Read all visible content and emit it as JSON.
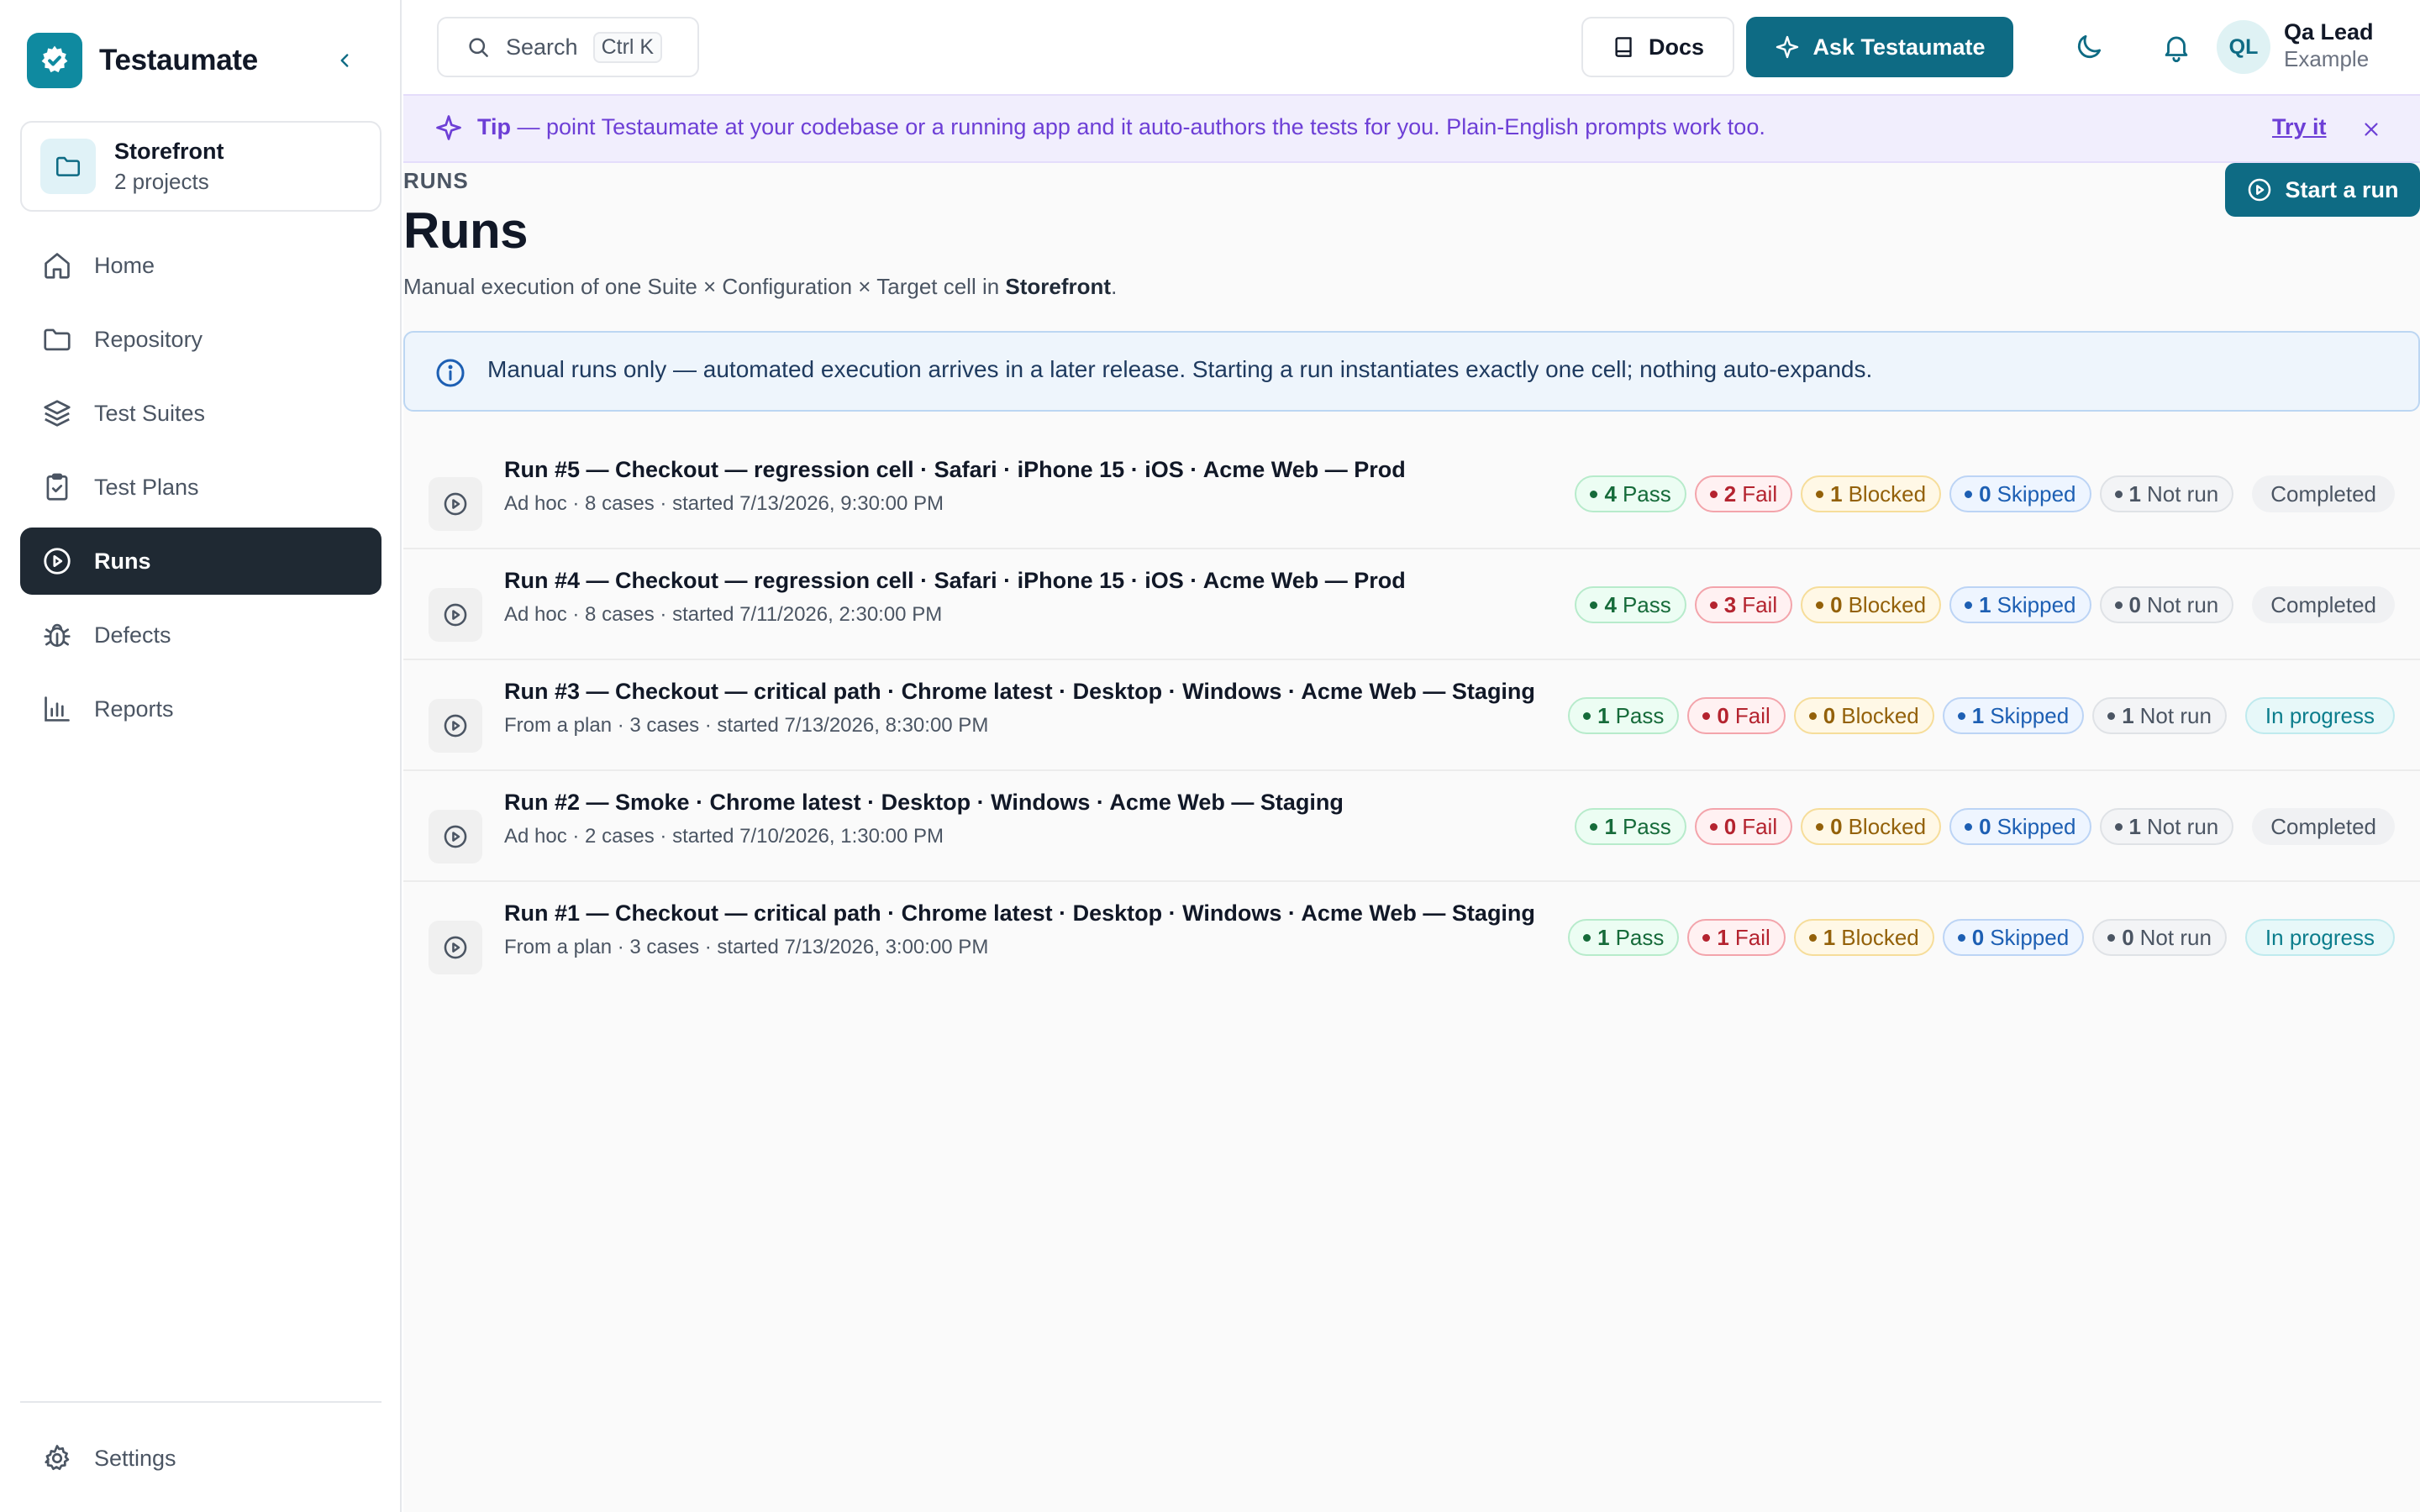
{
  "colors": {
    "brand": "#0f8aa0",
    "primary_button": "#0e6b84",
    "sidebar_active": "#1f2933",
    "tip_text": "#6d3fd6",
    "pass": "#166b3a",
    "fail": "#b4232f",
    "blocked": "#93610a",
    "skipped": "#1d5fb3",
    "not_run": "#4b5563",
    "in_progress": "#0b7d8c"
  },
  "brand": {
    "name": "Testaumate",
    "icon": "gear-icon"
  },
  "workspace": {
    "name": "Storefront",
    "sub": "2 projects",
    "icon": "folder-icon"
  },
  "nav": [
    {
      "label": "Home",
      "icon": "home-icon",
      "active": false
    },
    {
      "label": "Repository",
      "icon": "folder-icon",
      "active": false
    },
    {
      "label": "Test Suites",
      "icon": "layers-icon",
      "active": false
    },
    {
      "label": "Test Plans",
      "icon": "clipboard-check-icon",
      "active": false
    },
    {
      "label": "Runs",
      "icon": "play-circle-icon",
      "active": true
    },
    {
      "label": "Defects",
      "icon": "bug-icon",
      "active": false
    },
    {
      "label": "Reports",
      "icon": "bar-chart-icon",
      "active": false
    }
  ],
  "settings": {
    "label": "Settings",
    "icon": "gear-icon"
  },
  "topbar": {
    "search_label": "Search",
    "search_shortcut": "Ctrl K",
    "docs_label": "Docs",
    "ask_label": "Ask Testaumate",
    "user": {
      "initials": "QL",
      "name": "Qa Lead",
      "org": "Example"
    }
  },
  "tip": {
    "lead": "Tip",
    "text": " — point Testaumate at your codebase or a running app and it auto-authors the tests for you. Plain-English prompts work too.",
    "action": "Try it"
  },
  "page": {
    "eyebrow": "RUNS",
    "title": "Runs",
    "subtitle_prefix": "Manual execution of one Suite × Configuration × Target cell in ",
    "subtitle_project": "Storefront",
    "subtitle_suffix": ".",
    "start_button": "Start a run",
    "info": "Manual runs only — automated execution arrives in a later release. Starting a run instantiates exactly one cell; nothing auto-expands."
  },
  "labels": {
    "pass": "Pass",
    "fail": "Fail",
    "blocked": "Blocked",
    "skipped": "Skipped",
    "not_run": "Not run"
  },
  "runs": [
    {
      "title": "Run #5 — Checkout — regression cell · Safari · iPhone 15 · iOS · Acme Web — Prod",
      "meta": "Ad hoc · 8 cases · started 7/13/2026, 9:30:00 PM",
      "pass": 4,
      "fail": 2,
      "blocked": 1,
      "skipped": 0,
      "not_run": 1,
      "status": "Completed"
    },
    {
      "title": "Run #4 — Checkout — regression cell · Safari · iPhone 15 · iOS · Acme Web — Prod",
      "meta": "Ad hoc · 8 cases · started 7/11/2026, 2:30:00 PM",
      "pass": 4,
      "fail": 3,
      "blocked": 0,
      "skipped": 1,
      "not_run": 0,
      "status": "Completed"
    },
    {
      "title": "Run #3 — Checkout — critical path · Chrome latest · Desktop · Windows · Acme Web — Staging",
      "meta": "From a plan · 3 cases · started 7/13/2026, 8:30:00 PM",
      "pass": 1,
      "fail": 0,
      "blocked": 0,
      "skipped": 1,
      "not_run": 1,
      "status": "In progress"
    },
    {
      "title": "Run #2 — Smoke · Chrome latest · Desktop · Windows · Acme Web — Staging",
      "meta": "Ad hoc · 2 cases · started 7/10/2026, 1:30:00 PM",
      "pass": 1,
      "fail": 0,
      "blocked": 0,
      "skipped": 0,
      "not_run": 1,
      "status": "Completed"
    },
    {
      "title": "Run #1 — Checkout — critical path · Chrome latest · Desktop · Windows · Acme Web — Staging",
      "meta": "From a plan · 3 cases · started 7/13/2026, 3:00:00 PM",
      "pass": 1,
      "fail": 1,
      "blocked": 1,
      "skipped": 0,
      "not_run": 0,
      "status": "In progress"
    }
  ]
}
